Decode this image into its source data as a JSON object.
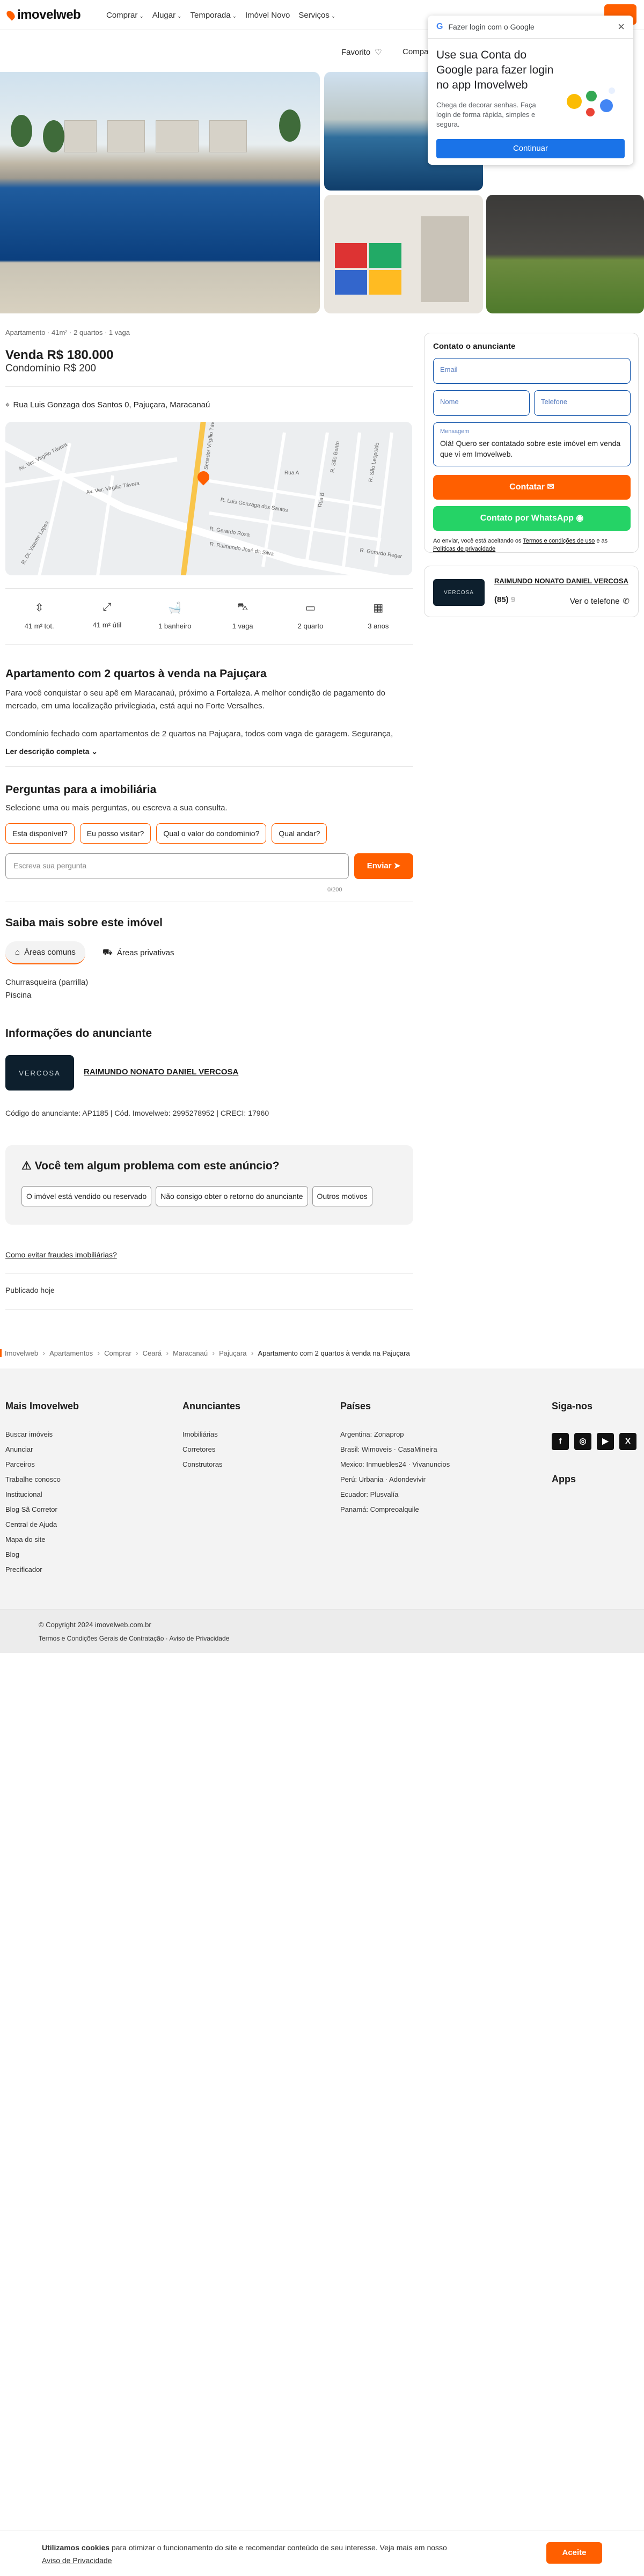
{
  "header": {
    "logo": "imovelweb",
    "nav": [
      "Comprar",
      "Alugar",
      "Temporada",
      "Imóvel Novo",
      "Serviços"
    ],
    "favorites": "Favorito",
    "compare": "Compa"
  },
  "google_popup": {
    "title": "Fazer login com o Google",
    "heading": "Use sua Conta do Google para fazer login no app Imovelweb",
    "body": "Chega de decorar senhas. Faça login de forma rápida, simples e segura.",
    "button": "Continuar"
  },
  "listing": {
    "summary": "Apartamento · 41m² · 2 quartos · 1 vaga",
    "price": "Venda R$ 180.000",
    "condo": "Condomínio R$ 200",
    "address": "Rua Luis Gonzaga dos Santos 0, Pajuçara, Maracanaú",
    "features": [
      {
        "icon": "area-total-icon",
        "label": "41 m² tot."
      },
      {
        "icon": "area-util-icon",
        "label": "41 m² útil"
      },
      {
        "icon": "bathroom-icon",
        "label": "1 banheiro"
      },
      {
        "icon": "parking-icon",
        "label": "1 vaga"
      },
      {
        "icon": "bedroom-icon",
        "label": "2 quarto"
      },
      {
        "icon": "age-icon",
        "label": "3 anos"
      }
    ],
    "title": "Apartamento com 2 quartos à venda na Pajuçara",
    "desc1": "Para você conquistar o seu apê em Maracanaú, próximo a Fortaleza. A melhor condição de pagamento do mercado, em uma localização privilegiada, está aqui no Forte Versalhes.",
    "desc2": "Condomínio fechado com apartamentos de 2 quartos na Pajuçara, todos com vaga de garagem. Segurança,",
    "read_more": "Ler descrição completa"
  },
  "map": {
    "streets": [
      "Av. Ver. Virgílio Távora",
      "Av. Ver. Virgílio Távora",
      "Av. Senador Virgílio Távora",
      "R. Luis Gonzaga dos Santos",
      "R. Gerardo Rosa",
      "R. Raimundo José da Silva",
      "R. Dr. Vicente Lopes",
      "R. São Bento",
      "R. São Leopoldo",
      "R. Gerardo Reger",
      "Rua B",
      "Rua A"
    ]
  },
  "questions": {
    "title": "Perguntas para a imobiliária",
    "subtitle": "Selecione uma ou mais perguntas, ou escreva a sua consulta.",
    "options": [
      "Esta disponível?",
      "Eu posso visitar?",
      "Qual o valor do condomínio?",
      "Qual andar?"
    ],
    "placeholder": "Escreva sua pergunta",
    "send": "Enviar",
    "counter": "0/200"
  },
  "more_info": {
    "title": "Saiba mais sobre este imóvel",
    "tabs": [
      "Áreas comuns",
      "Áreas privativas"
    ],
    "items": [
      "Churrasqueira (parrilla)",
      "Piscina"
    ]
  },
  "advertiser": {
    "title": "Informações do anunciante",
    "logo_text": "VERCOSA",
    "name": "RAIMUNDO NONATO DANIEL VERCOSA",
    "code": "Código do anunciante: AP1185 | Cód. Imovelweb: 2995278952 | CRECI: 17960"
  },
  "problem": {
    "title": "Você tem algum problema com este anúncio?",
    "options": [
      "O imóvel está vendido ou reservado",
      "Não consigo obter o retorno do anunciante",
      "Outros motivos"
    ]
  },
  "fraud_link": "Como evitar fraudes imobiliárias?",
  "published": "Publicado hoje",
  "contact": {
    "title": "Contato o anunciante",
    "email": "Email",
    "name": "Nome",
    "phone": "Telefone",
    "message_label": "Mensagem",
    "message": "Olá! Quero ser contatado sobre este imóvel em venda que vi em Imovelweb.",
    "contact_btn": "Contatar",
    "whatsapp_btn": "Contato por WhatsApp",
    "legal_prefix": "Ao enviar, você está aceitando os ",
    "legal_link1": "Termos e condições de uso",
    "legal_mid": " e as ",
    "legal_link2": "Políticas de privacidade"
  },
  "adv_card": {
    "logo_text": "VERCOSA",
    "name": "RAIMUNDO NONATO DANIEL VERCOSA",
    "phone": "(85)",
    "see_phone": "Ver o telefone"
  },
  "breadcrumb": [
    "Imovelweb",
    "Apartamentos",
    "Comprar",
    "Ceará",
    "Maracanaú",
    "Pajuçara",
    "Apartamento com 2 quartos à venda na Pajuçara"
  ],
  "footer": {
    "col1": {
      "title": "Mais Imovelweb",
      "items": [
        "Buscar imóveis",
        "Anunciar",
        "Parceiros",
        "Trabalhe conosco",
        "Institucional",
        "Blog Sã Corretor",
        "Central de Ajuda",
        "Mapa do site",
        "Blog",
        "Precificador"
      ]
    },
    "col2": {
      "title": "Anunciantes",
      "items": [
        "Imobiliárias",
        "Corretores",
        "Construtoras"
      ]
    },
    "col3": {
      "title": "Países",
      "items": [
        "Argentina: Zonaprop",
        "Brasil: Wimoveis · CasaMineira",
        "Mexico: Inmuebles24 · Vivanuncios",
        "Perú: Urbania · Adondevivir",
        "Ecuador: Plusvalía",
        "Panamá: Compreoalquile"
      ]
    },
    "follow": "Siga-nos",
    "apps": "Apps",
    "copyright": "© Copyright 2024 imovelweb.com.br",
    "terms": "Termos e Condições Gerais de Contratação · Aviso de Privacidade"
  },
  "cookie": {
    "bold": "Utilizamos cookies",
    "text": " para otimizar o funcionamento do site e recomendar conteúdo de seu interesse. Veja mais em nosso ",
    "link": "Aviso de Privacidade",
    "accept": "Aceite"
  },
  "colors": {
    "accent": "#ff5f00",
    "whatsapp": "#25d366",
    "google_blue": "#1a73e8"
  }
}
